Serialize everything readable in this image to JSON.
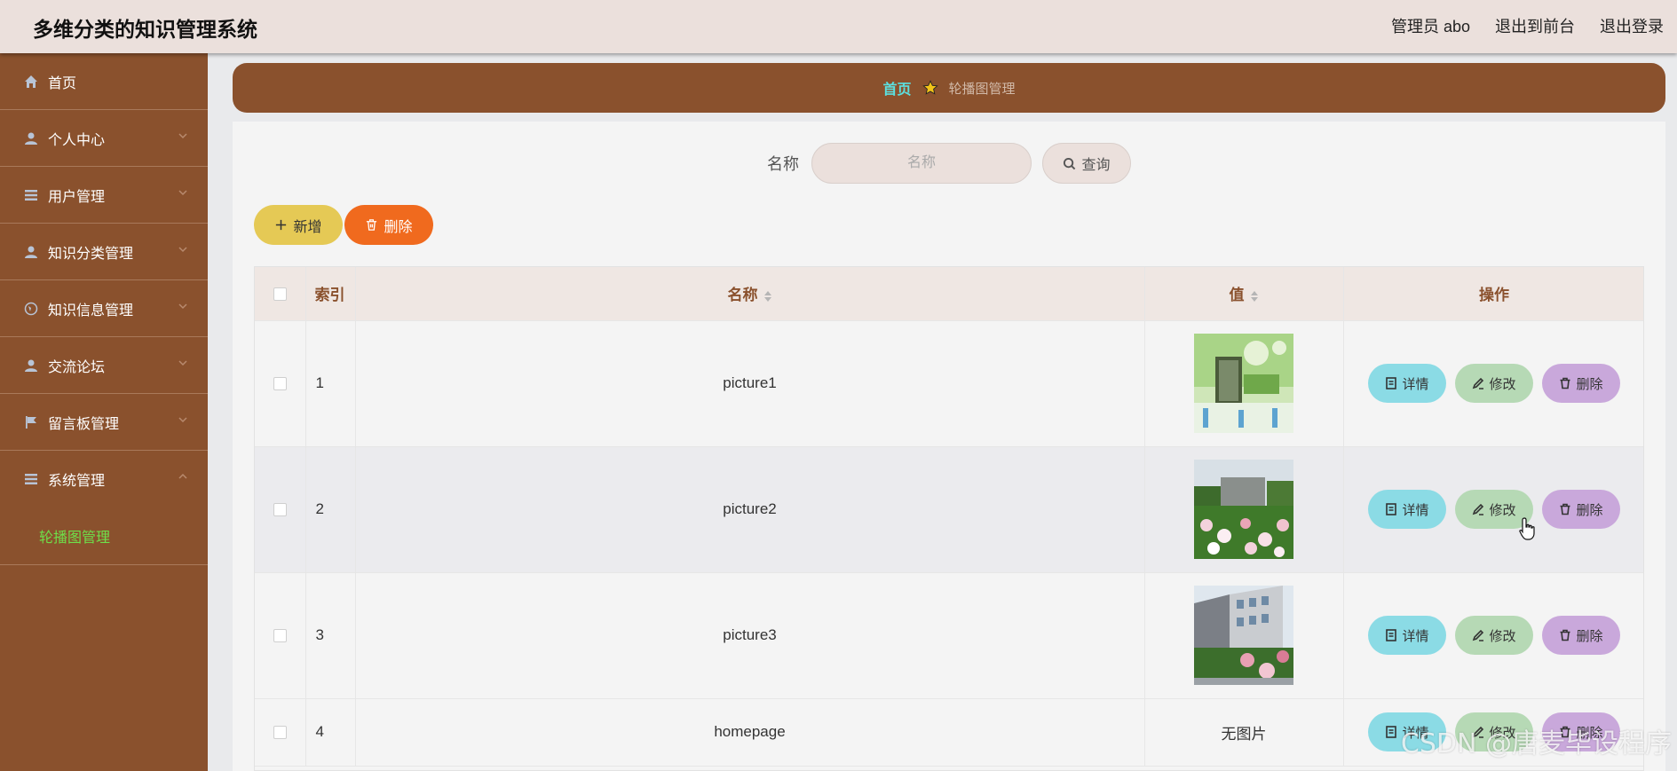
{
  "header": {
    "title": "多维分类的知识管理系统",
    "user_label": "管理员 abo",
    "front_link": "退出到前台",
    "logout_link": "退出登录"
  },
  "sidebar": {
    "items": [
      {
        "label": "首页",
        "icon": "home-icon"
      },
      {
        "label": "个人中心",
        "icon": "user-icon"
      },
      {
        "label": "用户管理",
        "icon": "list-icon"
      },
      {
        "label": "知识分类管理",
        "icon": "user-icon"
      },
      {
        "label": "知识信息管理",
        "icon": "globe-icon"
      },
      {
        "label": "交流论坛",
        "icon": "user-icon"
      },
      {
        "label": "留言板管理",
        "icon": "flag-icon"
      },
      {
        "label": "系统管理",
        "icon": "list-icon"
      }
    ],
    "sub_item": "轮播图管理"
  },
  "breadcrumb": {
    "home": "首页",
    "current": "轮播图管理"
  },
  "search": {
    "label": "名称",
    "placeholder": "名称",
    "button": "查询"
  },
  "actions": {
    "add": "新增",
    "delete": "删除"
  },
  "table": {
    "headers": {
      "index": "索引",
      "name": "名称",
      "value": "值",
      "ops": "操作"
    },
    "rows": [
      {
        "index": "1",
        "name": "picture1",
        "image": "green-banner"
      },
      {
        "index": "2",
        "name": "picture2",
        "image": "flowers-building"
      },
      {
        "index": "3",
        "name": "picture3",
        "image": "campus-building"
      },
      {
        "index": "4",
        "name": "homepage",
        "value_text": "无图片"
      }
    ],
    "op_labels": {
      "detail": "详情",
      "edit": "修改",
      "delete": "删除"
    }
  },
  "watermark": "CSDN @唐麦毕设程序",
  "colors": {
    "brown": "#8a512d",
    "header_bg": "#ebe0dc",
    "active_sub": "#6ee04a",
    "add_btn": "#e5c955",
    "delete_btn": "#f06a1e",
    "detail_btn": "#8bdbe5",
    "edit_btn": "#b6d9b5",
    "op_delete_btn": "#c9a8db"
  }
}
